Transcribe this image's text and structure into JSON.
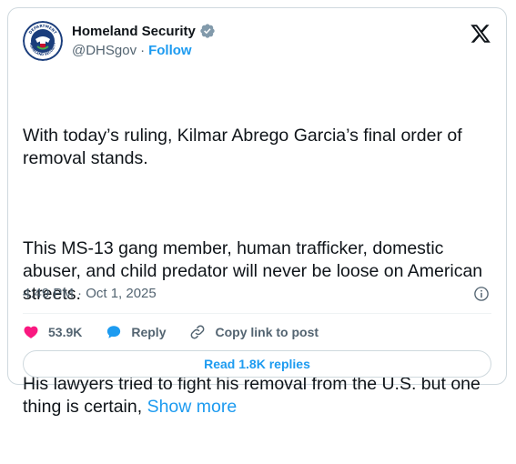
{
  "author": {
    "display_name": "Homeland Security",
    "handle": "@DHSgov",
    "separator": "·",
    "follow_label": "Follow",
    "seal_text_top": "DEPARTMENT",
    "seal_text_bottom": "HOMELAND SECURITY"
  },
  "tweet": {
    "paragraphs": [
      "With today’s ruling, Kilmar Abrego Garcia’s final order of removal stands.",
      "This MS-13 gang member, human trafficker, domestic abuser, and child predator will never be loose on American streets."
    ],
    "last_paragraph": "His lawyers tried to fight his removal from the U.S. but one thing is certain, ",
    "show_more_label": "Show more",
    "timestamp": "4:49 PM · Oct 1, 2025"
  },
  "actions": {
    "likes_count": "53.9K",
    "reply_label": "Reply",
    "copy_link_label": "Copy link to post"
  },
  "replies_button_label": "Read 1.8K replies",
  "colors": {
    "accent": "#1d9bf0",
    "like": "#f91880",
    "secondary_text": "#536471",
    "border": "#cfd9de"
  },
  "icons": {
    "brand": "x-logo-icon",
    "verified": "verified-badge-icon",
    "info": "info-icon",
    "like": "heart-icon",
    "reply": "speech-bubble-icon",
    "copy": "link-icon"
  }
}
